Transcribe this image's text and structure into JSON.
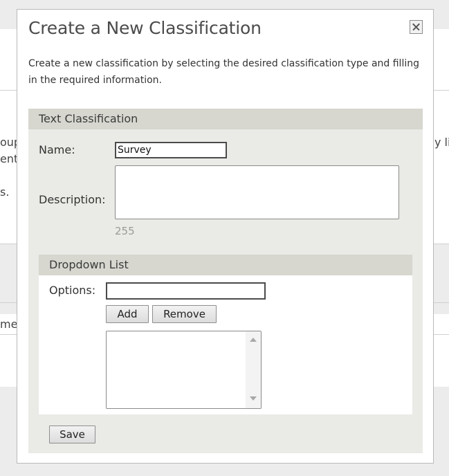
{
  "background": {
    "left_fragments": [
      "oup",
      "ent",
      "s.",
      "mer"
    ],
    "right_fragments": [
      "y li"
    ]
  },
  "dialog": {
    "title": "Create a New Classification",
    "intro": "Create a new classification by selecting the desired classification type and filling in the required information.",
    "close_icon": "close-icon"
  },
  "text_classification": {
    "header": "Text Classification",
    "name_label": "Name:",
    "name_value": "Survey",
    "description_label": "Description:",
    "description_value": "",
    "char_remaining": "255"
  },
  "dropdown_list": {
    "header": "Dropdown List",
    "options_label": "Options:",
    "options_value": "",
    "add_label": "Add",
    "remove_label": "Remove",
    "items": []
  },
  "footer": {
    "save_label": "Save"
  },
  "colors": {
    "panel_bg": "#eaeae6",
    "header_bg": "#d7d7d0",
    "page_bg": "#ececec"
  }
}
